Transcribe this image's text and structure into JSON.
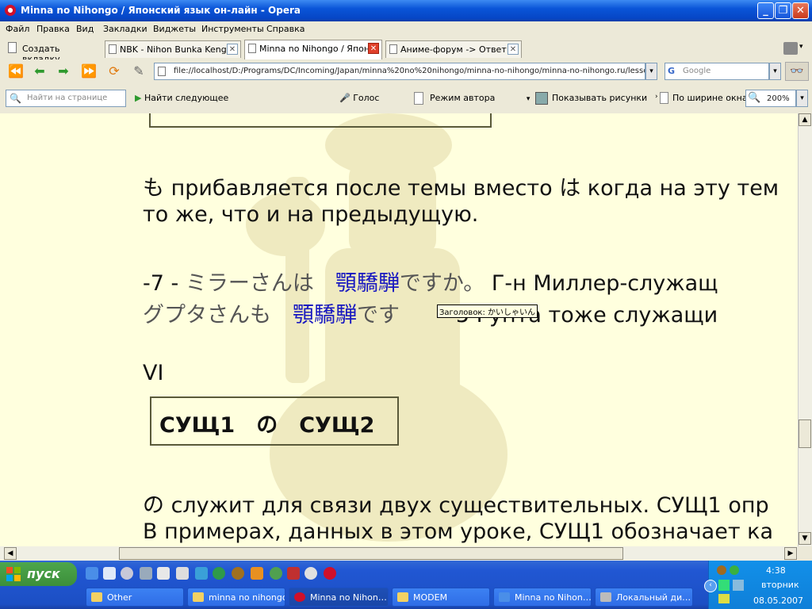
{
  "window": {
    "title": "Minna no Nihongo / Японский язык он-лайн - Opera"
  },
  "menu": [
    "Файл",
    "Правка",
    "Вид",
    "Закладки",
    "Виджеты",
    "Инструменты",
    "Справка"
  ],
  "tabs": {
    "new_tab": "Создать вкладку",
    "items": [
      {
        "label": "NBK - Nihon Bunka Keng…",
        "active": false
      },
      {
        "label": "Minna no Nihongo / Япон…",
        "active": true
      },
      {
        "label": "Аниме-форум -> Ответ …",
        "active": false
      }
    ]
  },
  "address": {
    "url": "file://localhost/D:/Programs/DC/Incoming/Japan/minna%20no%20nihongo/minna-no-nihongo/minna-no-nihongo.ru/lesson/",
    "search_placeholder": "Google"
  },
  "findbar": {
    "find_placeholder": "Найти на странице",
    "find_next": "Найти следующее",
    "voice": "Голос",
    "author_mode": "Режим автора",
    "show_images": "Показывать рисунки",
    "fit_width": "По ширине окна",
    "zoom": "200%"
  },
  "content": {
    "para1_line1_jp": "も",
    "para1_line1_a": " прибавляется после темы вместо ",
    "para1_line1_jp2": "は",
    "para1_line1_b": " когда на эту тем",
    "para1_line2": "то же, что и на предыдущую.",
    "ex7_num": "-7 - ",
    "ex7_jp": "ミラーさんは　",
    "ex7_link": "顎驕騨",
    "ex7_jp2": "ですか。",
    "ex7_ru": " Г-н Миллер-служащ",
    "ex7b_jp": "グプタさんも　",
    "ex7b_link": "顎驕騨",
    "ex7b_jp2": "です",
    "ex7b_mid": "5",
    "ex7b_ru": " Гупта тоже служащи",
    "tooltip": "Заголовок: かいしゃいん",
    "section": "VI",
    "box_text": "СУЩ1　の　СУЩ2",
    "para2_line1_jp": "の",
    "para2_line1": " служит для связи двух существительных. СУЩ1 опр",
    "para2_line2": "В примерах, данных в этом уроке, СУЩ1 обозначает ка"
  },
  "taskbar": {
    "start": "пуск",
    "tasks": [
      {
        "label": "Other",
        "active": false
      },
      {
        "label": "minna no nihongo",
        "active": false
      },
      {
        "label": "Minna no Nihon…",
        "active": true
      },
      {
        "label": "MODEM",
        "active": false
      },
      {
        "label": "Minna no Nihon…",
        "active": false
      },
      {
        "label": "Локальный ди…",
        "active": false
      }
    ],
    "time": "4:38",
    "weekday": "вторник",
    "date": "08.05.2007"
  }
}
